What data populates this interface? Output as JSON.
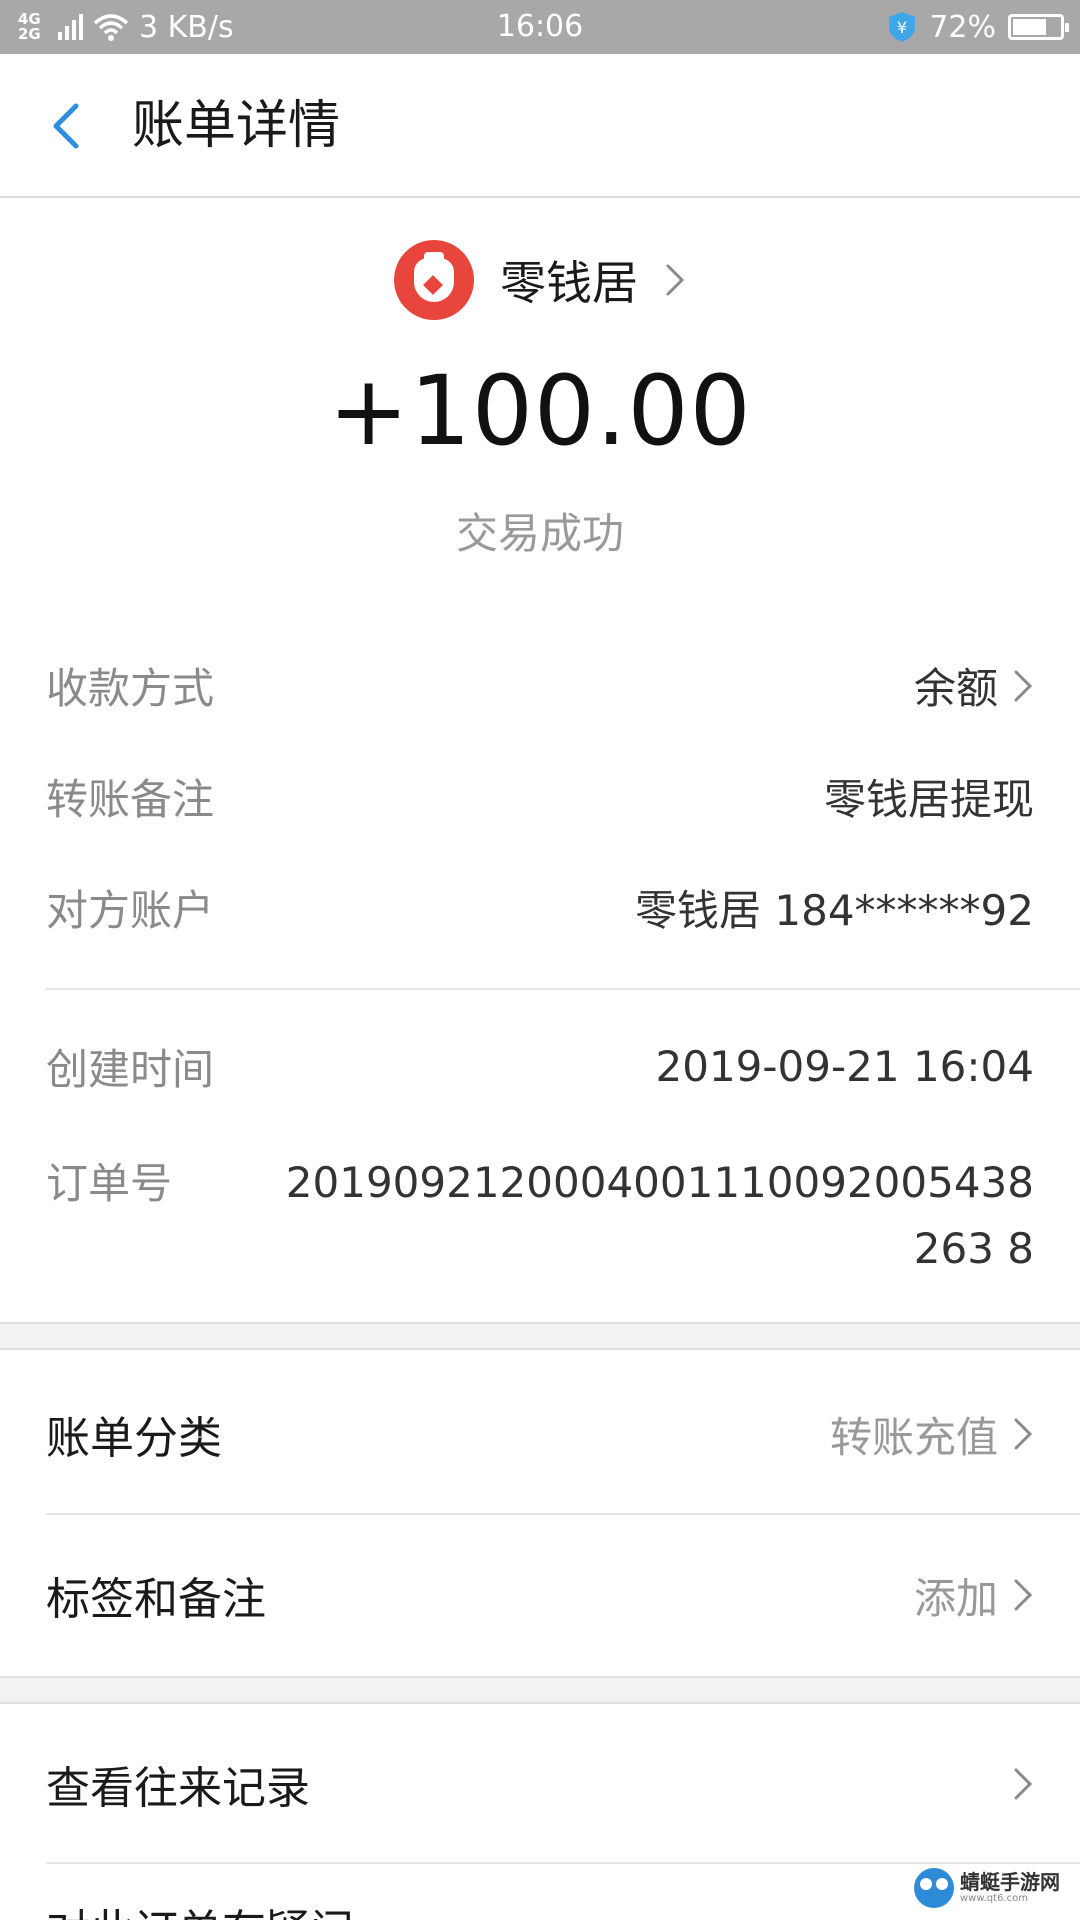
{
  "status_bar": {
    "network_top": "4G",
    "network_bottom": "2G",
    "speed": "3 KB/s",
    "time": "16:06",
    "battery_percent": "72%",
    "battery_level": 0.72,
    "icons": [
      "signal-icon",
      "wifi-icon",
      "shield-yen-icon",
      "battery-icon"
    ]
  },
  "nav": {
    "title": "账单详情",
    "back_icon": "chevron-left-icon"
  },
  "header": {
    "merchant_name": "零钱居",
    "amount": "+100.00",
    "status": "交易成功",
    "accent_color": "#e8453c"
  },
  "details": [
    {
      "label": "收款方式",
      "value": "余额",
      "has_chevron": true
    },
    {
      "label": "转账备注",
      "value": "零钱居提现",
      "has_chevron": false
    },
    {
      "label": "对方账户",
      "value": "零钱居 184******92",
      "has_chevron": false
    }
  ],
  "meta": {
    "created_label": "创建时间",
    "created_value": "2019-09-21 16:04",
    "order_label": "订单号",
    "order_value": "2019092120004001110092005438263 8"
  },
  "menu": {
    "category_label": "账单分类",
    "category_value": "转账充值",
    "tags_label": "标签和备注",
    "tags_value": "添加",
    "history_label": "查看往来记录"
  },
  "footer": {
    "partial_text": "对此订单有疑问",
    "watermark_title": "蜻蜓手游网",
    "watermark_sub": "www.qt6.com"
  }
}
